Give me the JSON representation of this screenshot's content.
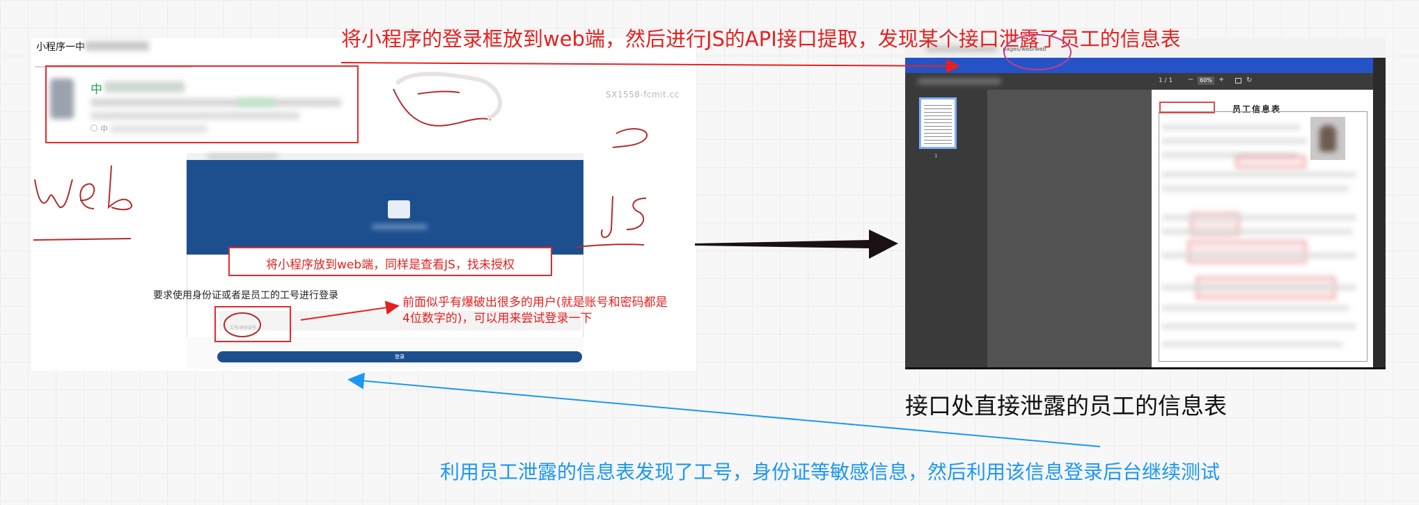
{
  "annotations": {
    "top_caption": "将小程序的登录框放到web端，然后进行JS的API接口提取，发现某个接口泄露了员工的信息表",
    "login_callout": "将小程序放到web端，同样是查看JS，找未授权",
    "id_requirement": "要求使用身份证或者是员工的工号进行登录",
    "bruteforce_note": "前面似乎有爆破出很多的用户(就是账号和密码都是4位数字的)，可以用来尝试登录一下",
    "right_caption": "接口处直接泄露的员工的信息表",
    "bottom_caption": "利用员工泄露的信息表发现了工号，身份证等敏感信息，然后利用该信息登录后台继续测试",
    "handwritten_web": "web",
    "handwritten_js": "JS"
  },
  "mini_program": {
    "title": "小程序一中",
    "card_title": "中",
    "card_status": "中",
    "watermark": "SX1558-fcmit.cc"
  },
  "login_page": {
    "id_placeholder": "工号/身份证号",
    "button_label": "登录"
  },
  "pdf_viewer": {
    "url_fragment": "pages/web/web",
    "page_indicator": "1 / 1",
    "zoom": "60%",
    "thumb_number": "1",
    "doc_title": "员工信息表"
  },
  "colors": {
    "annotation_red": "#e6201f",
    "annotation_blue": "#1b97f4",
    "banner_blue": "#1d4f8e",
    "viewer_blue": "#2453c8",
    "success_green": "#22a04a"
  }
}
